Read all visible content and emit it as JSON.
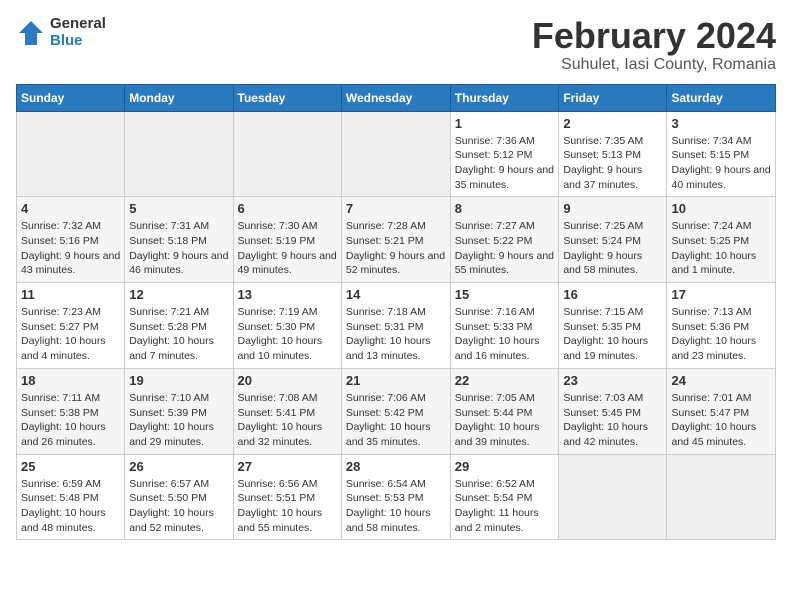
{
  "header": {
    "logo_general": "General",
    "logo_blue": "Blue",
    "title": "February 2024",
    "subtitle": "Suhulet, Iasi County, Romania"
  },
  "weekdays": [
    "Sunday",
    "Monday",
    "Tuesday",
    "Wednesday",
    "Thursday",
    "Friday",
    "Saturday"
  ],
  "weeks": [
    [
      {
        "day": "",
        "info": ""
      },
      {
        "day": "",
        "info": ""
      },
      {
        "day": "",
        "info": ""
      },
      {
        "day": "",
        "info": ""
      },
      {
        "day": "1",
        "info": "Sunrise: 7:36 AM\nSunset: 5:12 PM\nDaylight: 9 hours and 35 minutes."
      },
      {
        "day": "2",
        "info": "Sunrise: 7:35 AM\nSunset: 5:13 PM\nDaylight: 9 hours and 37 minutes."
      },
      {
        "day": "3",
        "info": "Sunrise: 7:34 AM\nSunset: 5:15 PM\nDaylight: 9 hours and 40 minutes."
      }
    ],
    [
      {
        "day": "4",
        "info": "Sunrise: 7:32 AM\nSunset: 5:16 PM\nDaylight: 9 hours and 43 minutes."
      },
      {
        "day": "5",
        "info": "Sunrise: 7:31 AM\nSunset: 5:18 PM\nDaylight: 9 hours and 46 minutes."
      },
      {
        "day": "6",
        "info": "Sunrise: 7:30 AM\nSunset: 5:19 PM\nDaylight: 9 hours and 49 minutes."
      },
      {
        "day": "7",
        "info": "Sunrise: 7:28 AM\nSunset: 5:21 PM\nDaylight: 9 hours and 52 minutes."
      },
      {
        "day": "8",
        "info": "Sunrise: 7:27 AM\nSunset: 5:22 PM\nDaylight: 9 hours and 55 minutes."
      },
      {
        "day": "9",
        "info": "Sunrise: 7:25 AM\nSunset: 5:24 PM\nDaylight: 9 hours and 58 minutes."
      },
      {
        "day": "10",
        "info": "Sunrise: 7:24 AM\nSunset: 5:25 PM\nDaylight: 10 hours and 1 minute."
      }
    ],
    [
      {
        "day": "11",
        "info": "Sunrise: 7:23 AM\nSunset: 5:27 PM\nDaylight: 10 hours and 4 minutes."
      },
      {
        "day": "12",
        "info": "Sunrise: 7:21 AM\nSunset: 5:28 PM\nDaylight: 10 hours and 7 minutes."
      },
      {
        "day": "13",
        "info": "Sunrise: 7:19 AM\nSunset: 5:30 PM\nDaylight: 10 hours and 10 minutes."
      },
      {
        "day": "14",
        "info": "Sunrise: 7:18 AM\nSunset: 5:31 PM\nDaylight: 10 hours and 13 minutes."
      },
      {
        "day": "15",
        "info": "Sunrise: 7:16 AM\nSunset: 5:33 PM\nDaylight: 10 hours and 16 minutes."
      },
      {
        "day": "16",
        "info": "Sunrise: 7:15 AM\nSunset: 5:35 PM\nDaylight: 10 hours and 19 minutes."
      },
      {
        "day": "17",
        "info": "Sunrise: 7:13 AM\nSunset: 5:36 PM\nDaylight: 10 hours and 23 minutes."
      }
    ],
    [
      {
        "day": "18",
        "info": "Sunrise: 7:11 AM\nSunset: 5:38 PM\nDaylight: 10 hours and 26 minutes."
      },
      {
        "day": "19",
        "info": "Sunrise: 7:10 AM\nSunset: 5:39 PM\nDaylight: 10 hours and 29 minutes."
      },
      {
        "day": "20",
        "info": "Sunrise: 7:08 AM\nSunset: 5:41 PM\nDaylight: 10 hours and 32 minutes."
      },
      {
        "day": "21",
        "info": "Sunrise: 7:06 AM\nSunset: 5:42 PM\nDaylight: 10 hours and 35 minutes."
      },
      {
        "day": "22",
        "info": "Sunrise: 7:05 AM\nSunset: 5:44 PM\nDaylight: 10 hours and 39 minutes."
      },
      {
        "day": "23",
        "info": "Sunrise: 7:03 AM\nSunset: 5:45 PM\nDaylight: 10 hours and 42 minutes."
      },
      {
        "day": "24",
        "info": "Sunrise: 7:01 AM\nSunset: 5:47 PM\nDaylight: 10 hours and 45 minutes."
      }
    ],
    [
      {
        "day": "25",
        "info": "Sunrise: 6:59 AM\nSunset: 5:48 PM\nDaylight: 10 hours and 48 minutes."
      },
      {
        "day": "26",
        "info": "Sunrise: 6:57 AM\nSunset: 5:50 PM\nDaylight: 10 hours and 52 minutes."
      },
      {
        "day": "27",
        "info": "Sunrise: 6:56 AM\nSunset: 5:51 PM\nDaylight: 10 hours and 55 minutes."
      },
      {
        "day": "28",
        "info": "Sunrise: 6:54 AM\nSunset: 5:53 PM\nDaylight: 10 hours and 58 minutes."
      },
      {
        "day": "29",
        "info": "Sunrise: 6:52 AM\nSunset: 5:54 PM\nDaylight: 11 hours and 2 minutes."
      },
      {
        "day": "",
        "info": ""
      },
      {
        "day": "",
        "info": ""
      }
    ]
  ]
}
